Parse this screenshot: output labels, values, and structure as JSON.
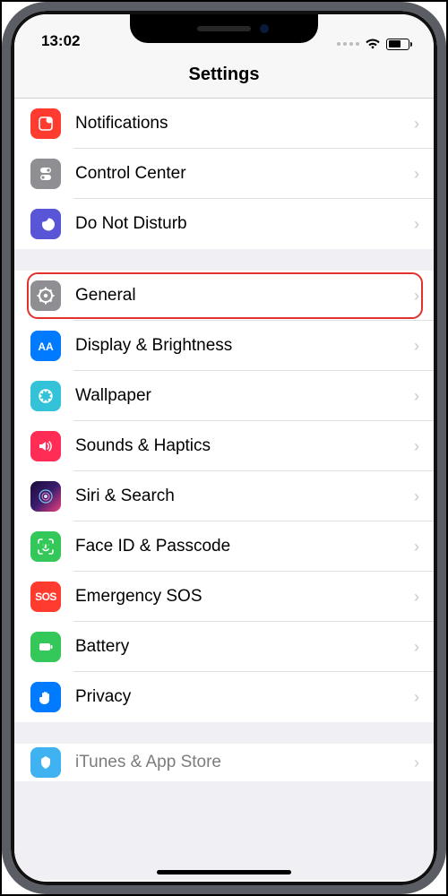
{
  "status": {
    "time": "13:02"
  },
  "header": {
    "title": "Settings"
  },
  "groups": [
    {
      "rows": [
        {
          "id": "notifications",
          "label": "Notifications"
        },
        {
          "id": "control-center",
          "label": "Control Center"
        },
        {
          "id": "dnd",
          "label": "Do Not Disturb"
        }
      ]
    },
    {
      "rows": [
        {
          "id": "general",
          "label": "General",
          "highlighted": true
        },
        {
          "id": "display",
          "label": "Display & Brightness"
        },
        {
          "id": "wallpaper",
          "label": "Wallpaper"
        },
        {
          "id": "sounds",
          "label": "Sounds & Haptics"
        },
        {
          "id": "siri",
          "label": "Siri & Search"
        },
        {
          "id": "faceid",
          "label": "Face ID & Passcode"
        },
        {
          "id": "sos",
          "label": "Emergency SOS"
        },
        {
          "id": "battery",
          "label": "Battery"
        },
        {
          "id": "privacy",
          "label": "Privacy"
        }
      ]
    },
    {
      "rows": [
        {
          "id": "appstore",
          "label": "iTunes & App Store"
        }
      ]
    }
  ],
  "sos_text": "SOS"
}
